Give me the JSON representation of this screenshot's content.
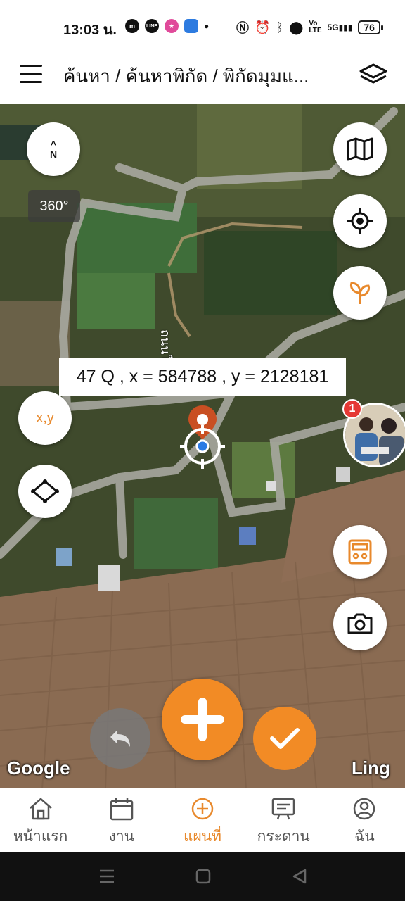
{
  "status_bar": {
    "time": "13:03 น.",
    "battery": "76",
    "network": "5G"
  },
  "header": {
    "title": "ค้นหา / ค้นหาพิกัด / พิกัดมุมแ..."
  },
  "map": {
    "compass_letter": "N",
    "rotation_label": "360°",
    "coordinate_readout": "47 Q , x = 584788 , y = 2128181",
    "xy_button_label": "x,y",
    "avatar_badge_count": "1",
    "road_label": "ถนนใหญ่",
    "attribution_google": "Google",
    "attribution_ling": "Ling"
  },
  "colors": {
    "accent": "#f28b25",
    "pin": "#c94f22",
    "location_dot": "#2b7be4"
  },
  "bottom_nav": {
    "items": [
      {
        "label": "หน้าแรก",
        "icon": "home-icon"
      },
      {
        "label": "งาน",
        "icon": "calendar-icon"
      },
      {
        "label": "แผนที่",
        "icon": "plus-circle-icon",
        "active": true
      },
      {
        "label": "กระดาน",
        "icon": "board-icon"
      },
      {
        "label": "ฉัน",
        "icon": "profile-icon"
      }
    ]
  }
}
